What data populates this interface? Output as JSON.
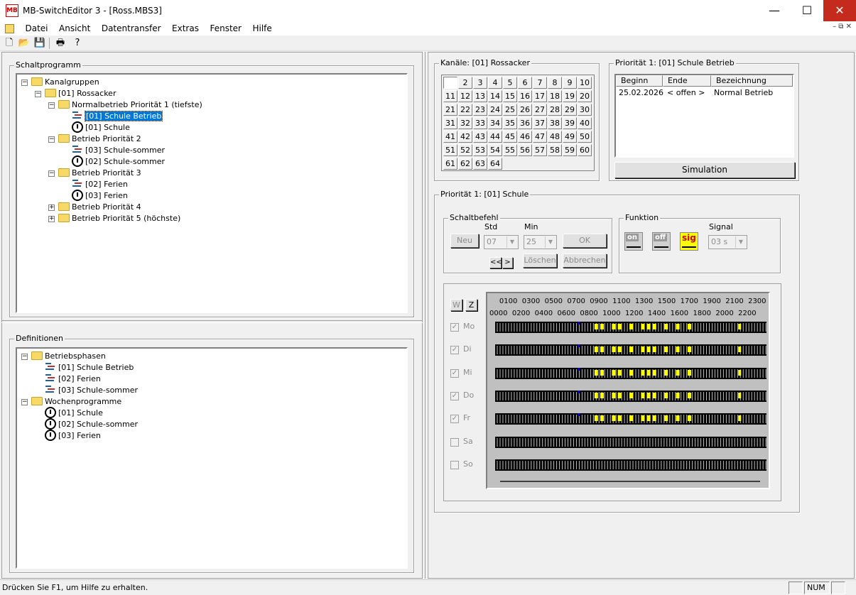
{
  "window": {
    "logo": "MB",
    "title": "MB-SwitchEditor 3 - [Ross.MBS3]",
    "minimize": "—",
    "maximize": "☐",
    "close": "✕"
  },
  "menu": {
    "items": [
      "Datei",
      "Ansicht",
      "Datentransfer",
      "Extras",
      "Fenster",
      "Hilfe"
    ],
    "mdi_controls": "–  ⧉  ✕"
  },
  "toolbar": {
    "icons": [
      "new-file-icon",
      "open-folder-icon",
      "save-disk-icon",
      "print-icon",
      "help-icon"
    ]
  },
  "schaltprogramm": {
    "title": "Schaltprogramm",
    "tree": [
      {
        "label": "Kanalgruppen",
        "icon": "folder"
      },
      {
        "label": "[01] Rossacker",
        "icon": "folder"
      },
      {
        "label": "Normalbetrieb Priorität 1 (tiefste)",
        "icon": "folder"
      },
      {
        "label": "[01] Schule Betrieb",
        "icon": "phase",
        "selected": true
      },
      {
        "label": "[01] Schule",
        "icon": "clock"
      },
      {
        "label": "Betrieb Priorität 2",
        "icon": "folder"
      },
      {
        "label": "[03] Schule-sommer",
        "icon": "phase"
      },
      {
        "label": "[02] Schule-sommer",
        "icon": "clock"
      },
      {
        "label": "Betrieb Priorität 3",
        "icon": "folder"
      },
      {
        "label": "[02] Ferien",
        "icon": "phase"
      },
      {
        "label": "[03] Ferien",
        "icon": "clock"
      },
      {
        "label": "Betrieb Priorität 4",
        "icon": "folder"
      },
      {
        "label": "Betrieb Priorität 5 (höchste)",
        "icon": "folder"
      }
    ]
  },
  "definitionen": {
    "title": "Definitionen",
    "tree": [
      {
        "label": "Betriebsphasen",
        "icon": "folder"
      },
      {
        "label": "[01] Schule Betrieb",
        "icon": "phase"
      },
      {
        "label": "[02] Ferien",
        "icon": "phase"
      },
      {
        "label": "[03] Schule-sommer",
        "icon": "phase"
      },
      {
        "label": "Wochenprogramme",
        "icon": "folder"
      },
      {
        "label": "[01] Schule",
        "icon": "clock"
      },
      {
        "label": "[02] Schule-sommer",
        "icon": "clock"
      },
      {
        "label": "[03] Ferien",
        "icon": "clock"
      }
    ]
  },
  "kanaele": {
    "title": "Kanäle: [01] Rossacker",
    "channels": [
      "",
      "2",
      "3",
      "4",
      "5",
      "6",
      "7",
      "8",
      "9",
      "10",
      "11",
      "12",
      "13",
      "14",
      "15",
      "16",
      "17",
      "18",
      "19",
      "20",
      "21",
      "22",
      "23",
      "24",
      "25",
      "26",
      "27",
      "28",
      "29",
      "30",
      "31",
      "32",
      "33",
      "34",
      "35",
      "36",
      "37",
      "38",
      "39",
      "40",
      "41",
      "42",
      "43",
      "44",
      "45",
      "46",
      "47",
      "48",
      "49",
      "50",
      "51",
      "52",
      "53",
      "54",
      "55",
      "56",
      "57",
      "58",
      "59",
      "60",
      "61",
      "62",
      "63",
      "64"
    ]
  },
  "prioritaet_phase": {
    "title": "Priorität 1: [01] Schule Betrieb",
    "columns": [
      "Beginn",
      "Ende",
      "Bezeichnung"
    ],
    "row": [
      "25.02.2026",
      "< offen >",
      "Normal Betrieb"
    ],
    "simulation_label": "Simulation"
  },
  "prioritaet_prog": {
    "title": "Priorität 1: [01] Schule",
    "schaltbefehl": {
      "title": "Schaltbefehl",
      "neu": "Neu",
      "std_label": "Std",
      "std_value": "07",
      "min_label": "Min",
      "min_value": "25",
      "ok": "OK",
      "prev": "<<",
      "next": ">",
      "loeschen": "Löschen",
      "abbrechen": "Abbrechen"
    },
    "funktion": {
      "title": "Funktion",
      "on": "on",
      "off": "off",
      "sig": "sig",
      "signal_label": "Signal",
      "signal_value": "03 s"
    },
    "w_btn": "W",
    "z_btn": "Z",
    "hours_top": [
      "0100",
      "0300",
      "0500",
      "0700",
      "0900",
      "1100",
      "1300",
      "1500",
      "1700",
      "1900",
      "2100",
      "2300"
    ],
    "hours_bottom": [
      "0000",
      "0200",
      "0400",
      "0600",
      "0800",
      "1000",
      "1200",
      "1400",
      "1600",
      "1800",
      "2000",
      "2200"
    ],
    "days": [
      {
        "label": "Mo",
        "checked": true
      },
      {
        "label": "Di",
        "checked": true
      },
      {
        "label": "Mi",
        "checked": true
      },
      {
        "label": "Do",
        "checked": true
      },
      {
        "label": "Fr",
        "checked": true
      },
      {
        "label": "Sa",
        "checked": false
      },
      {
        "label": "So",
        "checked": false
      }
    ],
    "colors": {
      "on": "#ffff00",
      "marker": "#0000ff",
      "off": "#000000"
    }
  },
  "status": {
    "help": "Drücken Sie F1, um Hilfe zu erhalten.",
    "num": "NUM"
  }
}
